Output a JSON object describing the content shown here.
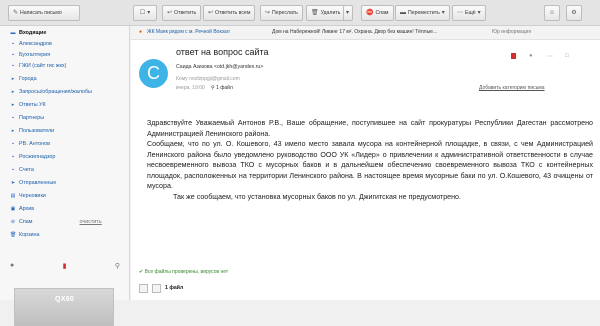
{
  "toolbar": {
    "compose": "Написать письмо",
    "reply": "Ответить",
    "reply_all": "Ответить всем",
    "forward": "Переслать",
    "delete": "Удалить",
    "spam": "Спам",
    "move": "Переместить",
    "more": "Ещё"
  },
  "sidebar": {
    "items": [
      {
        "label": "Входящие"
      },
      {
        "label": "Александров"
      },
      {
        "label": "Бухгалтерия"
      },
      {
        "label": "ГЖИ (сайт гис жкх)"
      },
      {
        "label": "Города"
      },
      {
        "label": "Запросы/обращения/жалобы"
      },
      {
        "label": "Ответы УК"
      },
      {
        "label": "Партнеры"
      },
      {
        "label": "Пользователи"
      },
      {
        "label": "РВ. Антонов"
      },
      {
        "label": "Росжилнадзор"
      },
      {
        "label": "Счета"
      },
      {
        "label": "Отправленные"
      },
      {
        "label": "Черновики"
      },
      {
        "label": "Архив"
      },
      {
        "label": "Спам"
      },
      {
        "label": "Корзина"
      }
    ],
    "clear_label": "очистить",
    "ad_text": "QX60"
  },
  "infobar": {
    "promo": "ЖК Маяк рядом с м. Речной Вокзал",
    "promo2": "Дом на Набережной! Ливинг 17 м². Охрана. Двор без машин! Тёплые...",
    "ads_label": "Юр информация"
  },
  "message": {
    "avatar_letter": "С",
    "subject": "ответ на вопрос сайта",
    "sender": "Саида Азизова <otd.jkh@yandex.ru>",
    "to": "Кому  noofzppgji@gmail.com",
    "date": "вчера, 19:00",
    "files": "1 файл",
    "add_category": "Добавить категорию письма",
    "paragraphs": [
      "Здравствуйте Уважаемый Антонов Р.В., Ваше обращение, поступившее на сайт прокуратуры Республики Дагестан рассмотрено Администрацией Ленинского района.",
      "Сообщаем, что по ул. О. Кошевого, 43 имело место завала мусора на контейнерной площадке, в связи, с чем Администрацией Ленинского района было уведомлено руководство ООО УК «Лидер» о привлечении к административной ответственности в случае несвоевременного вывоза ТКО с мусорных баков и в дальнейшем обеспечению своевременного вывоза ТКО с контейнерных площадок, расположенных на территории Ленинского района. В настоящее время мусорные баки по ул. О.Кошевого, 43 очищены от мусора.",
      "Так же сообщаем, что установка  мусорных баков по ул. Джигитская не предусмотрено."
    ],
    "virus_check": "Все файлы проверены, вирусов нет",
    "attachments_count": "1 файл"
  }
}
